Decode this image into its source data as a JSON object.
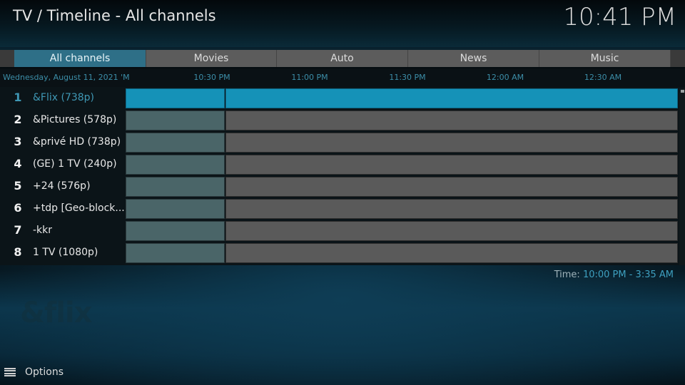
{
  "header": {
    "title": "TV / Timeline - All channels",
    "clock": "10:41 PM"
  },
  "tabs": [
    {
      "label": "All channels",
      "active": true
    },
    {
      "label": "Movies",
      "active": false
    },
    {
      "label": "Auto",
      "active": false
    },
    {
      "label": "News",
      "active": false
    },
    {
      "label": "Music",
      "active": false
    }
  ],
  "timeline": {
    "date": "Wednesday, August 11, 2021 'M",
    "ticks": [
      "10:30 PM",
      "11:00 PM",
      "11:30 PM",
      "12:00 AM",
      "12:30 AM"
    ]
  },
  "channels": [
    {
      "number": "1",
      "name": "&Flix (738p)",
      "selected": true
    },
    {
      "number": "2",
      "name": "&Pictures (578p)",
      "selected": false
    },
    {
      "number": "3",
      "name": "&privé HD (738p)",
      "selected": false
    },
    {
      "number": "4",
      "name": "(GE) 1 TV (240p)",
      "selected": false
    },
    {
      "number": "5",
      "name": "+24 (576p)",
      "selected": false
    },
    {
      "number": "6",
      "name": "+tdp [Geo-block...",
      "selected": false
    },
    {
      "number": "7",
      "name": "-kkr",
      "selected": false
    },
    {
      "number": "8",
      "name": "1 TV (1080p)",
      "selected": false
    }
  ],
  "time_range": {
    "label": "Time:",
    "value": "10:00 PM - 3:35 AM"
  },
  "logo_text": "&flix",
  "footer": {
    "options_label": "Options",
    "options_icon": "hamburger-menu-icon"
  },
  "colors": {
    "accent": "#1592b8",
    "active_tab": "#2e6f87",
    "timeline_text": "#3c8ea8"
  }
}
